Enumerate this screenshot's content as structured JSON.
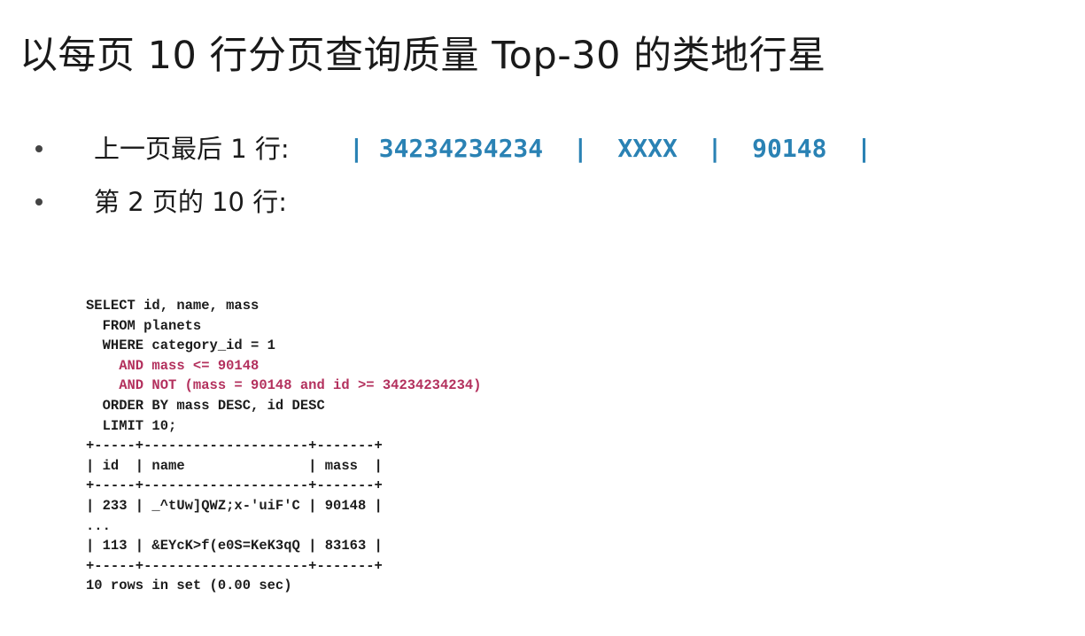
{
  "title": "以每页 10 行分页查询质量 Top-30 的类地行星",
  "bullets": [
    {
      "text": "上一页最后 1 行:",
      "code": "| 34234234234  |  XXXX  |  90148  |"
    },
    {
      "text": "第 2 页的 10 行:",
      "code": ""
    }
  ],
  "code_lines": [
    {
      "text": "SELECT id, name, mass",
      "highlight": false
    },
    {
      "text": "  FROM planets",
      "highlight": false
    },
    {
      "text": "  WHERE category_id = 1",
      "highlight": false
    },
    {
      "text": "    AND mass <= 90148",
      "highlight": true
    },
    {
      "text": "    AND NOT (mass = 90148 and id >= 34234234234)",
      "highlight": true
    },
    {
      "text": "  ORDER BY mass DESC, id DESC",
      "highlight": false
    },
    {
      "text": "  LIMIT 10;",
      "highlight": false
    },
    {
      "text": "+-----+--------------------+-------+",
      "highlight": false
    },
    {
      "text": "| id  | name               | mass  |",
      "highlight": false
    },
    {
      "text": "+-----+--------------------+-------+",
      "highlight": false
    },
    {
      "text": "| 233 | _^tUw]QWZ;x-'uiF'C | 90148 |",
      "highlight": false
    },
    {
      "text": "...",
      "highlight": false
    },
    {
      "text": "| 113 | &EYcK>f(e0S=KeK3qQ | 83163 |",
      "highlight": false
    },
    {
      "text": "+-----+--------------------+-------+",
      "highlight": false
    },
    {
      "text": "10 rows in set (0.00 sec)",
      "highlight": false
    }
  ],
  "colors": {
    "code_highlight": "#b3305d",
    "inline_code": "#2a82b4",
    "text": "#1a1a1a"
  }
}
